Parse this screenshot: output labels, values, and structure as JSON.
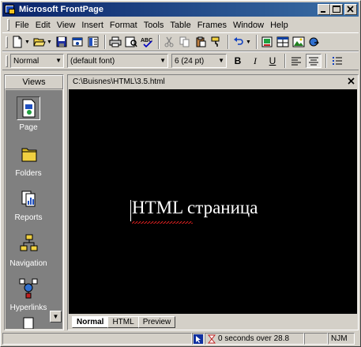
{
  "window": {
    "title": "Microsoft FrontPage"
  },
  "menubar": {
    "items": [
      "File",
      "Edit",
      "View",
      "Insert",
      "Format",
      "Tools",
      "Table",
      "Frames",
      "Window",
      "Help"
    ]
  },
  "format_toolbar": {
    "style_value": "Normal",
    "font_value": "(default font)",
    "size_value": "6  (24 pt)",
    "bold": "B",
    "italic": "I",
    "underline": "U"
  },
  "views": {
    "header": "Views",
    "items": [
      {
        "label": "Page",
        "icon": "page-view-icon"
      },
      {
        "label": "Folders",
        "icon": "folder-icon"
      },
      {
        "label": "Reports",
        "icon": "reports-icon"
      },
      {
        "label": "Navigation",
        "icon": "navigation-icon"
      },
      {
        "label": "Hyperlinks",
        "icon": "hyperlinks-icon"
      }
    ]
  },
  "document": {
    "path": "C:\\Buisnes\\HTML\\3.5.html",
    "content_text": "HTML страница",
    "background_color": "#000000",
    "text_color": "#ffffff",
    "tabs": [
      "Normal",
      "HTML",
      "Preview"
    ]
  },
  "statusbar": {
    "download_time": "0 seconds over 28.8",
    "mode": "NJM"
  }
}
